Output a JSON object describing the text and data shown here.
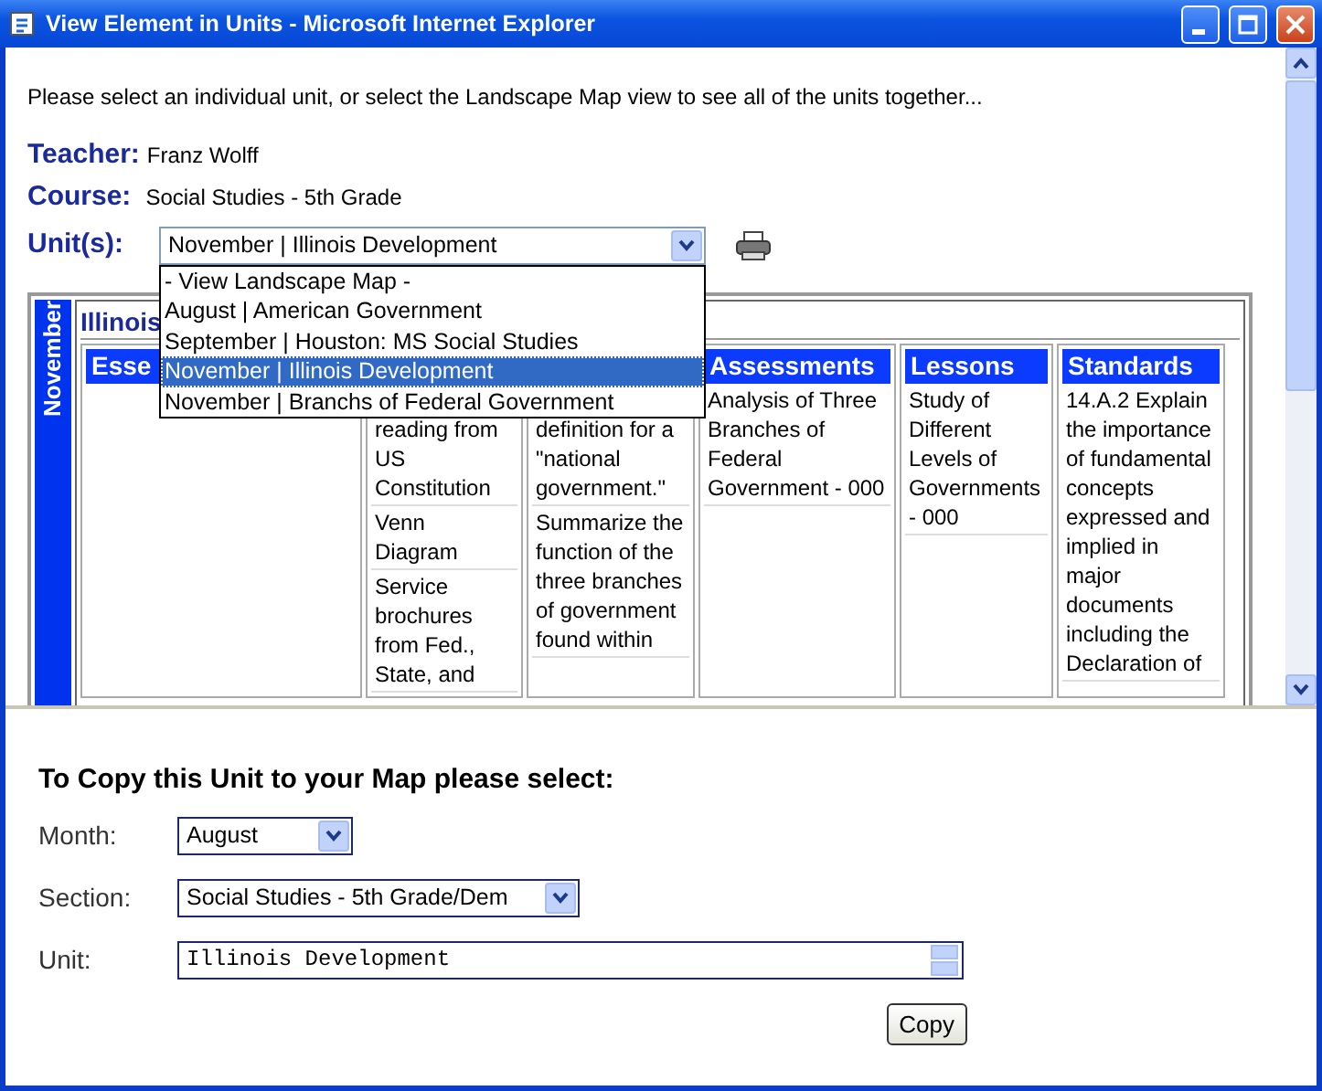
{
  "window": {
    "title": "View Element in Units - Microsoft Internet Explorer"
  },
  "intro": "Please select an individual unit, or select the Landscape Map view to see all of the units together...",
  "teacher": {
    "label": "Teacher:",
    "value": "Franz Wolff"
  },
  "course": {
    "label": "Course:",
    "value": "Social Studies - 5th Grade"
  },
  "units": {
    "label": "Unit(s):",
    "value": "November | Illinois Development",
    "expanded": true,
    "options": [
      {
        "label": "- View Landscape Map -",
        "selected": false
      },
      {
        "label": "August | American Government",
        "selected": false
      },
      {
        "label": "September | Houston: MS Social Studies",
        "selected": false
      },
      {
        "label": "November | Illinois Development",
        "selected": true
      },
      {
        "label": "November | Branchs of Federal Government",
        "selected": false
      }
    ]
  },
  "map": {
    "month": "November",
    "unit_title": "Illinois",
    "columns": [
      {
        "heading": "Esse"
      },
      {
        "cells": [
          "reading from US Constitution",
          "Venn Diagram",
          "Service brochures from Fed., State, and"
        ]
      },
      {
        "cells": [
          "definition for a \"national government.\"",
          "Summarize the function of the three branches of government found within"
        ]
      },
      {
        "heading": "Assessments",
        "cells": [
          "Analysis of Three Branches of Federal Government - 000"
        ]
      },
      {
        "heading": "Lessons",
        "cells": [
          "Study of Different Levels of Governments - 000"
        ]
      },
      {
        "heading": "Standards",
        "cells": [
          "14.A.2 Explain the importance of fundamental concepts expressed and implied in major documents including the Declaration of"
        ]
      }
    ]
  },
  "copy_form": {
    "heading": "To Copy this Unit to your Map please select:",
    "fields": [
      {
        "kind": "select",
        "label": "Month:",
        "value": "August"
      },
      {
        "kind": "select",
        "label": "Section:",
        "value": "Social Studies - 5th Grade/Dem"
      },
      {
        "kind": "text",
        "label": "Unit:",
        "value": "Illinois Development"
      }
    ],
    "button": "Copy"
  }
}
